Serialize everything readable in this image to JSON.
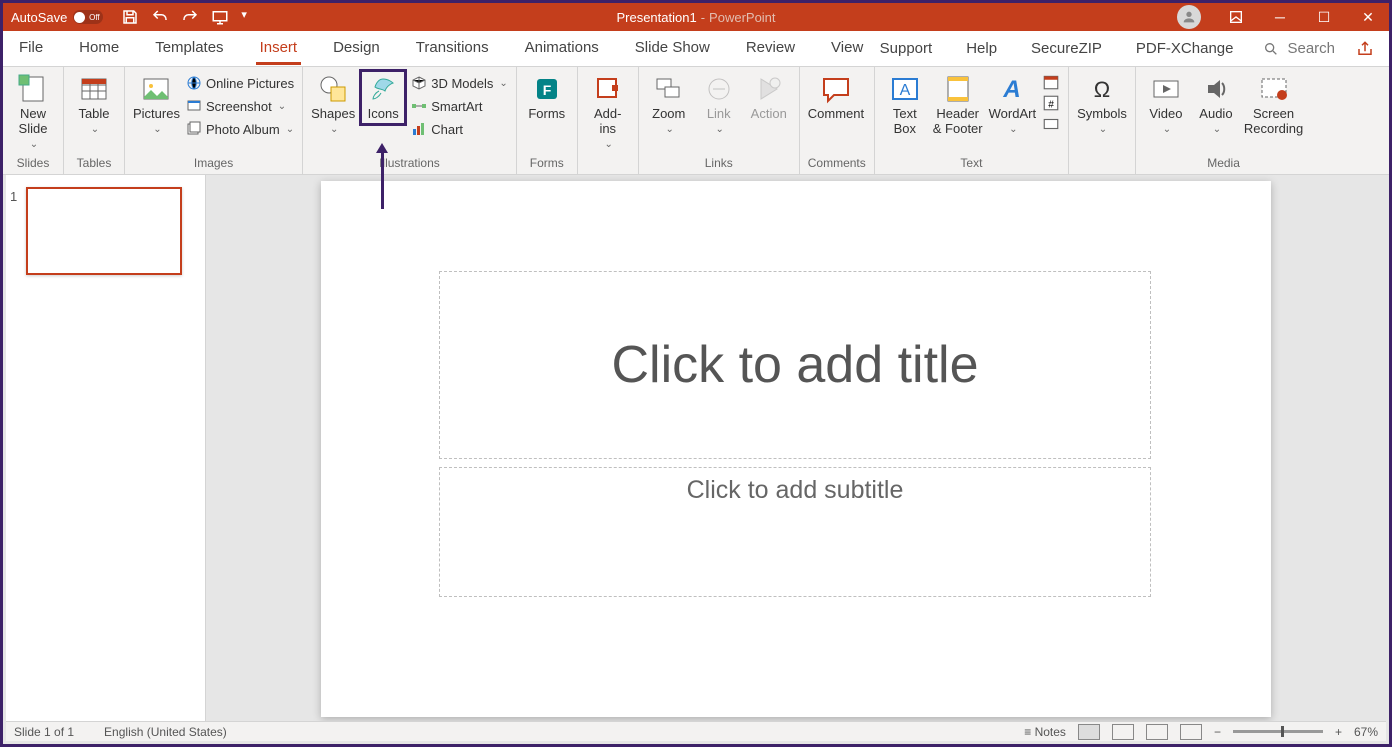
{
  "title": {
    "autosave_label": "AutoSave",
    "autosave_state": "Off",
    "doc": "Presentation1",
    "sep": "-",
    "app": "PowerPoint"
  },
  "tabs": {
    "file": "File",
    "home": "Home",
    "templates": "Templates",
    "insert": "Insert",
    "design": "Design",
    "transitions": "Transitions",
    "animations": "Animations",
    "slideshow": "Slide Show",
    "review": "Review",
    "view": "View"
  },
  "rtabs": {
    "support": "Support",
    "help": "Help",
    "securezip": "SecureZIP",
    "pdfx": "PDF-XChange",
    "search": "Search"
  },
  "ribbon": {
    "slides": {
      "new_slide": "New\nSlide",
      "label": "Slides"
    },
    "tables": {
      "table": "Table",
      "label": "Tables"
    },
    "images": {
      "pictures": "Pictures",
      "online": "Online Pictures",
      "screenshot": "Screenshot",
      "album": "Photo Album",
      "label": "Images"
    },
    "illus": {
      "shapes": "Shapes",
      "icons": "Icons",
      "models": "3D Models",
      "smartart": "SmartArt",
      "chart": "Chart",
      "label": "Illustrations"
    },
    "forms": {
      "forms": "Forms",
      "label": "Forms"
    },
    "addins": {
      "addins": "Add-\nins",
      "label": ""
    },
    "links": {
      "zoom": "Zoom",
      "link": "Link",
      "action": "Action",
      "label": "Links"
    },
    "comments": {
      "comment": "Comment",
      "label": "Comments"
    },
    "text": {
      "textbox": "Text\nBox",
      "header": "Header\n& Footer",
      "wordart": "WordArt",
      "label": "Text"
    },
    "symbols": {
      "symbols": "Symbols",
      "label": ""
    },
    "media": {
      "video": "Video",
      "audio": "Audio",
      "screen": "Screen\nRecording",
      "label": "Media"
    }
  },
  "canvas": {
    "title_ph": "Click to add title",
    "sub_ph": "Click to add subtitle"
  },
  "status": {
    "slide": "Slide 1 of 1",
    "lang": "English (United States)",
    "notes": "Notes",
    "zoom": "67%"
  },
  "thumb_num": "1"
}
